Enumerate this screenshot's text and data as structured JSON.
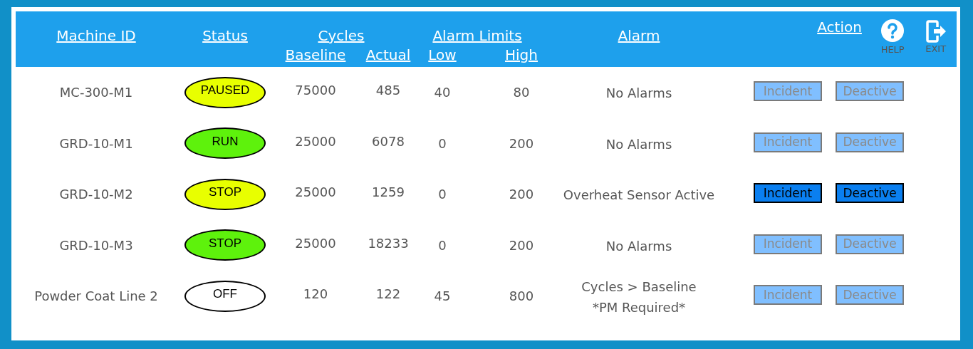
{
  "header": {
    "machine_id": "Machine ID",
    "status": "Status",
    "cycles": "Cycles",
    "baseline": "Baseline",
    "actual": "Actual",
    "alarm_limits": "Alarm Limits",
    "low": "Low",
    "high": "High",
    "alarm": "Alarm",
    "action": "Action",
    "help": "HELP",
    "exit": "EXIT"
  },
  "rows": [
    {
      "machine": "MC-300-M1",
      "status": "PAUSED",
      "color": "#e8ff00",
      "baseline": "75000",
      "actual": "485",
      "low": "40",
      "high": "80",
      "alarm": [
        "No Alarms"
      ],
      "incident": {
        "label": "Incident",
        "disabled": true
      },
      "deactive": {
        "label": "Deactive",
        "disabled": true
      }
    },
    {
      "machine": "GRD-10-M1",
      "status": "RUN",
      "color": "#5ef20c",
      "baseline": "25000",
      "actual": "6078",
      "low": "0",
      "high": "200",
      "alarm": [
        "No Alarms"
      ],
      "incident": {
        "label": "Incident",
        "disabled": true
      },
      "deactive": {
        "label": "Deactive",
        "disabled": true
      }
    },
    {
      "machine": "GRD-10-M2",
      "status": "STOP",
      "color": "#e8ff00",
      "baseline": "25000",
      "actual": "1259",
      "low": "0",
      "high": "200",
      "alarm": [
        "Overheat Sensor Active"
      ],
      "incident": {
        "label": "Incident",
        "disabled": false
      },
      "deactive": {
        "label": "Deactive",
        "disabled": false
      }
    },
    {
      "machine": "GRD-10-M3",
      "status": "STOP",
      "color": "#5ef20c",
      "baseline": "25000",
      "actual": "18233",
      "low": "0",
      "high": "200",
      "alarm": [
        "No Alarms"
      ],
      "incident": {
        "label": "Incident",
        "disabled": true
      },
      "deactive": {
        "label": "Deactive",
        "disabled": true
      }
    },
    {
      "machine": "Powder Coat Line 2",
      "status": "OFF",
      "color": "#ffffff",
      "baseline": "120",
      "actual": "122",
      "low": "45",
      "high": "800",
      "alarm": [
        "Cycles > Baseline",
        "*PM Required*"
      ],
      "incident": {
        "label": "Incident",
        "disabled": true
      },
      "deactive": {
        "label": "Deactive",
        "disabled": true
      }
    }
  ]
}
